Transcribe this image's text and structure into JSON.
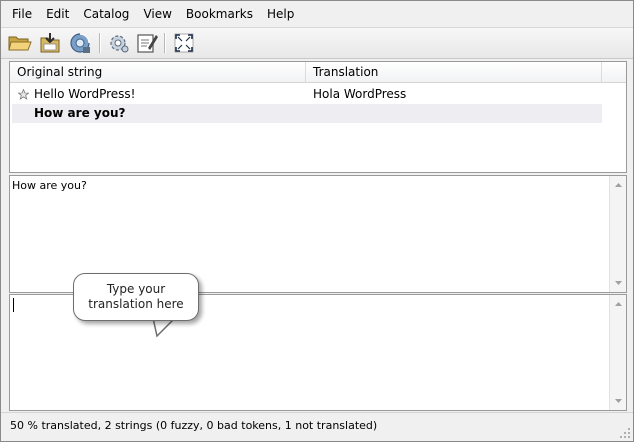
{
  "menu": {
    "items": [
      "File",
      "Edit",
      "Catalog",
      "View",
      "Bookmarks",
      "Help"
    ]
  },
  "toolbar": {
    "buttons": [
      {
        "icon": "open-folder-icon"
      },
      {
        "icon": "save-icon"
      },
      {
        "icon": "update-catalog-icon"
      },
      {
        "icon": "settings-gear-icon"
      },
      {
        "icon": "edit-comment-icon"
      },
      {
        "icon": "fullscreen-icon"
      }
    ]
  },
  "list": {
    "columns": {
      "original": "Original string",
      "translation": "Translation"
    },
    "rows": [
      {
        "original": "Hello WordPress!",
        "translation": "Hola WordPress",
        "starred": true,
        "selected": false
      },
      {
        "original": "How are you?",
        "translation": "",
        "starred": false,
        "selected": true
      }
    ]
  },
  "source_pane": {
    "text": "How are you?"
  },
  "translation_pane": {
    "text": ""
  },
  "callout": {
    "line1": "Type your",
    "line2": "translation here"
  },
  "status": {
    "text": "50 % translated, 2 strings (0 fuzzy, 0 bad tokens, 1 not translated)"
  },
  "colors": {
    "selected_row": "#eeeef2",
    "toolbar_bg": "#e8e8e8",
    "window_bg": "#f0f0f0"
  }
}
